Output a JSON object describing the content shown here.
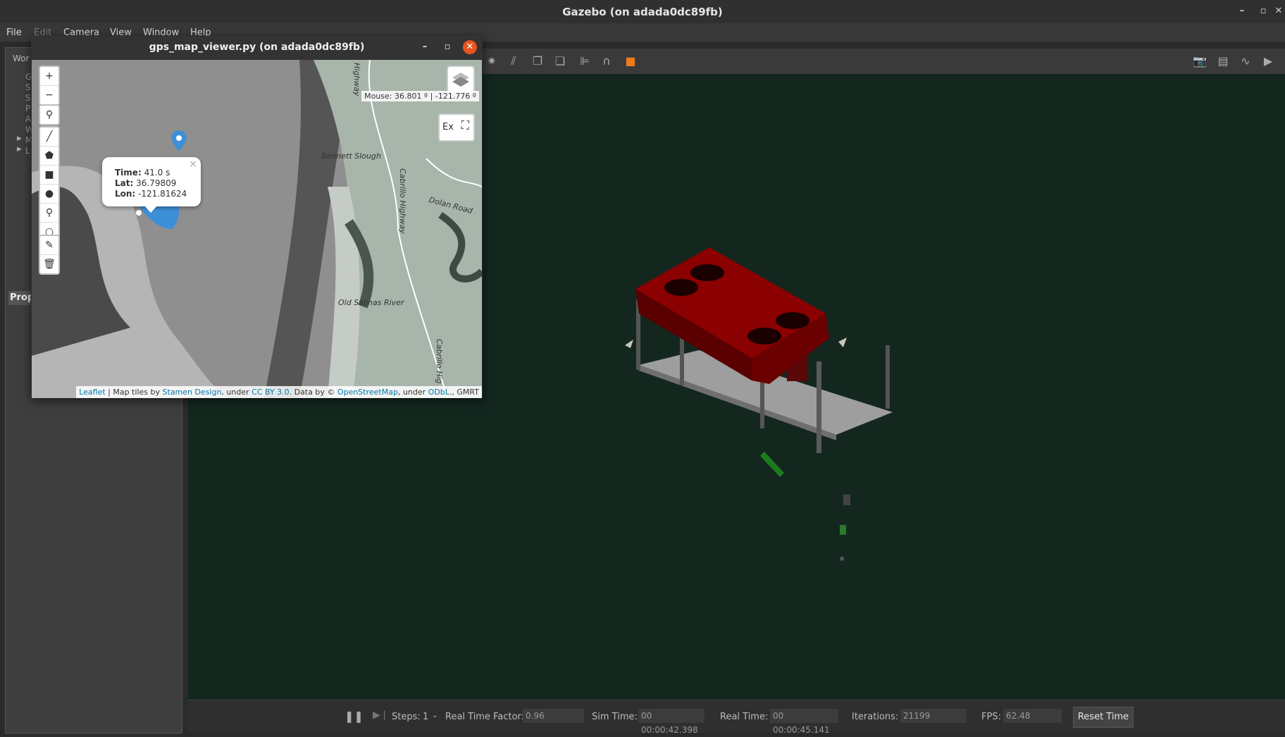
{
  "window": {
    "title": "Gazebo (on adada0dc89fb)"
  },
  "menu": [
    "File",
    "Edit",
    "Camera",
    "View",
    "Window",
    "Help"
  ],
  "left_panel": {
    "tab": "Wor",
    "props_label": "Prop",
    "tree_letters": [
      "G",
      "S",
      "S",
      "P",
      "A",
      "W",
      "M",
      "L"
    ]
  },
  "map_window": {
    "title": "gps_map_viewer.py (on adada0dc89fb)",
    "mouse_readout": "Mouse: 36.801 º | -121.776 º",
    "export_label": "Ex",
    "popup": {
      "time_label": "Time:",
      "time_value": "41.0 s",
      "lat_label": "Lat:",
      "lat_value": "36.79809",
      "lon_label": "Lon:",
      "lon_value": "-121.81624"
    },
    "map_labels": {
      "highway_top": "Highway",
      "bennett": "Bennett Slough",
      "cabrillo1": "Cabrillo Highway",
      "dolan": "Dolan Road",
      "river": "Old Salinas River",
      "cabrillo2": "Cabrillo Hig"
    },
    "attribution": {
      "leaflet": "Leaflet",
      "t1": " | Map tiles by ",
      "stamen": "Stamen Design",
      "t2": ", under ",
      "ccby": "CC BY 3.0",
      "t3": ". Data by © ",
      "osm": "OpenStreetMap",
      "t4": ", under ",
      "odbl": "ODbL",
      "t5": "., GMRT"
    }
  },
  "status": {
    "steps_label": "Steps:",
    "steps_value": "1",
    "rtf_label": "Real Time Factor:",
    "rtf_value": "0.96",
    "sim_label": "Sim Time:",
    "sim_value": "00 00:00:42.398",
    "real_label": "Real Time:",
    "real_value": "00 00:00:45.141",
    "iter_label": "Iterations:",
    "iter_value": "21199",
    "fps_label": "FPS:",
    "fps_value": "62.48",
    "reset_label": "Reset Time"
  },
  "colors": {
    "viewport": "#13271f",
    "rov_top": "#8b0000",
    "marker": "#3d8fd8"
  }
}
